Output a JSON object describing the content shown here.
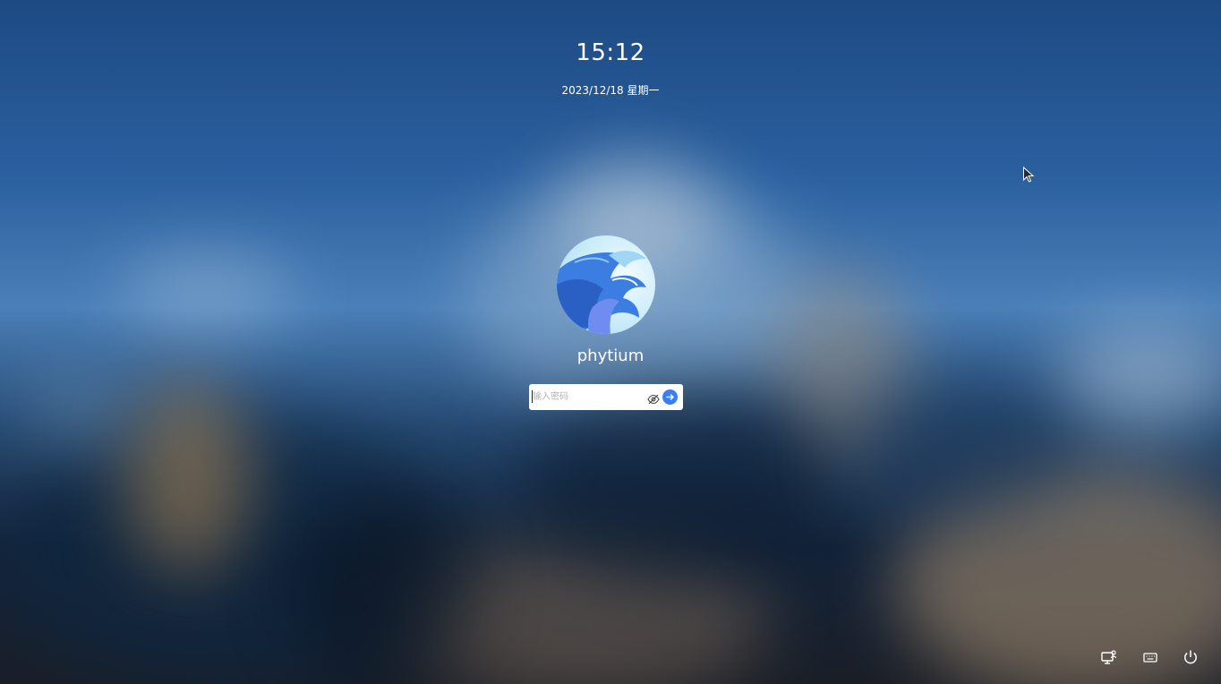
{
  "lockscreen": {
    "time": "15:12",
    "date": "2023/12/18 星期一",
    "user": {
      "name": "phytium",
      "avatar_icon": "dragon-avatar-icon"
    },
    "password": {
      "value": "",
      "placeholder": "输入密码",
      "toggle_icon": "eye-hidden-icon",
      "submit_icon": "arrow-right-icon"
    },
    "tray": [
      {
        "name": "switch-user-icon"
      },
      {
        "name": "keyboard-icon"
      },
      {
        "name": "power-icon"
      }
    ]
  },
  "colors": {
    "accent": "#3a7ff2",
    "text": "#ffffff",
    "input_bg": "#ffffff"
  }
}
